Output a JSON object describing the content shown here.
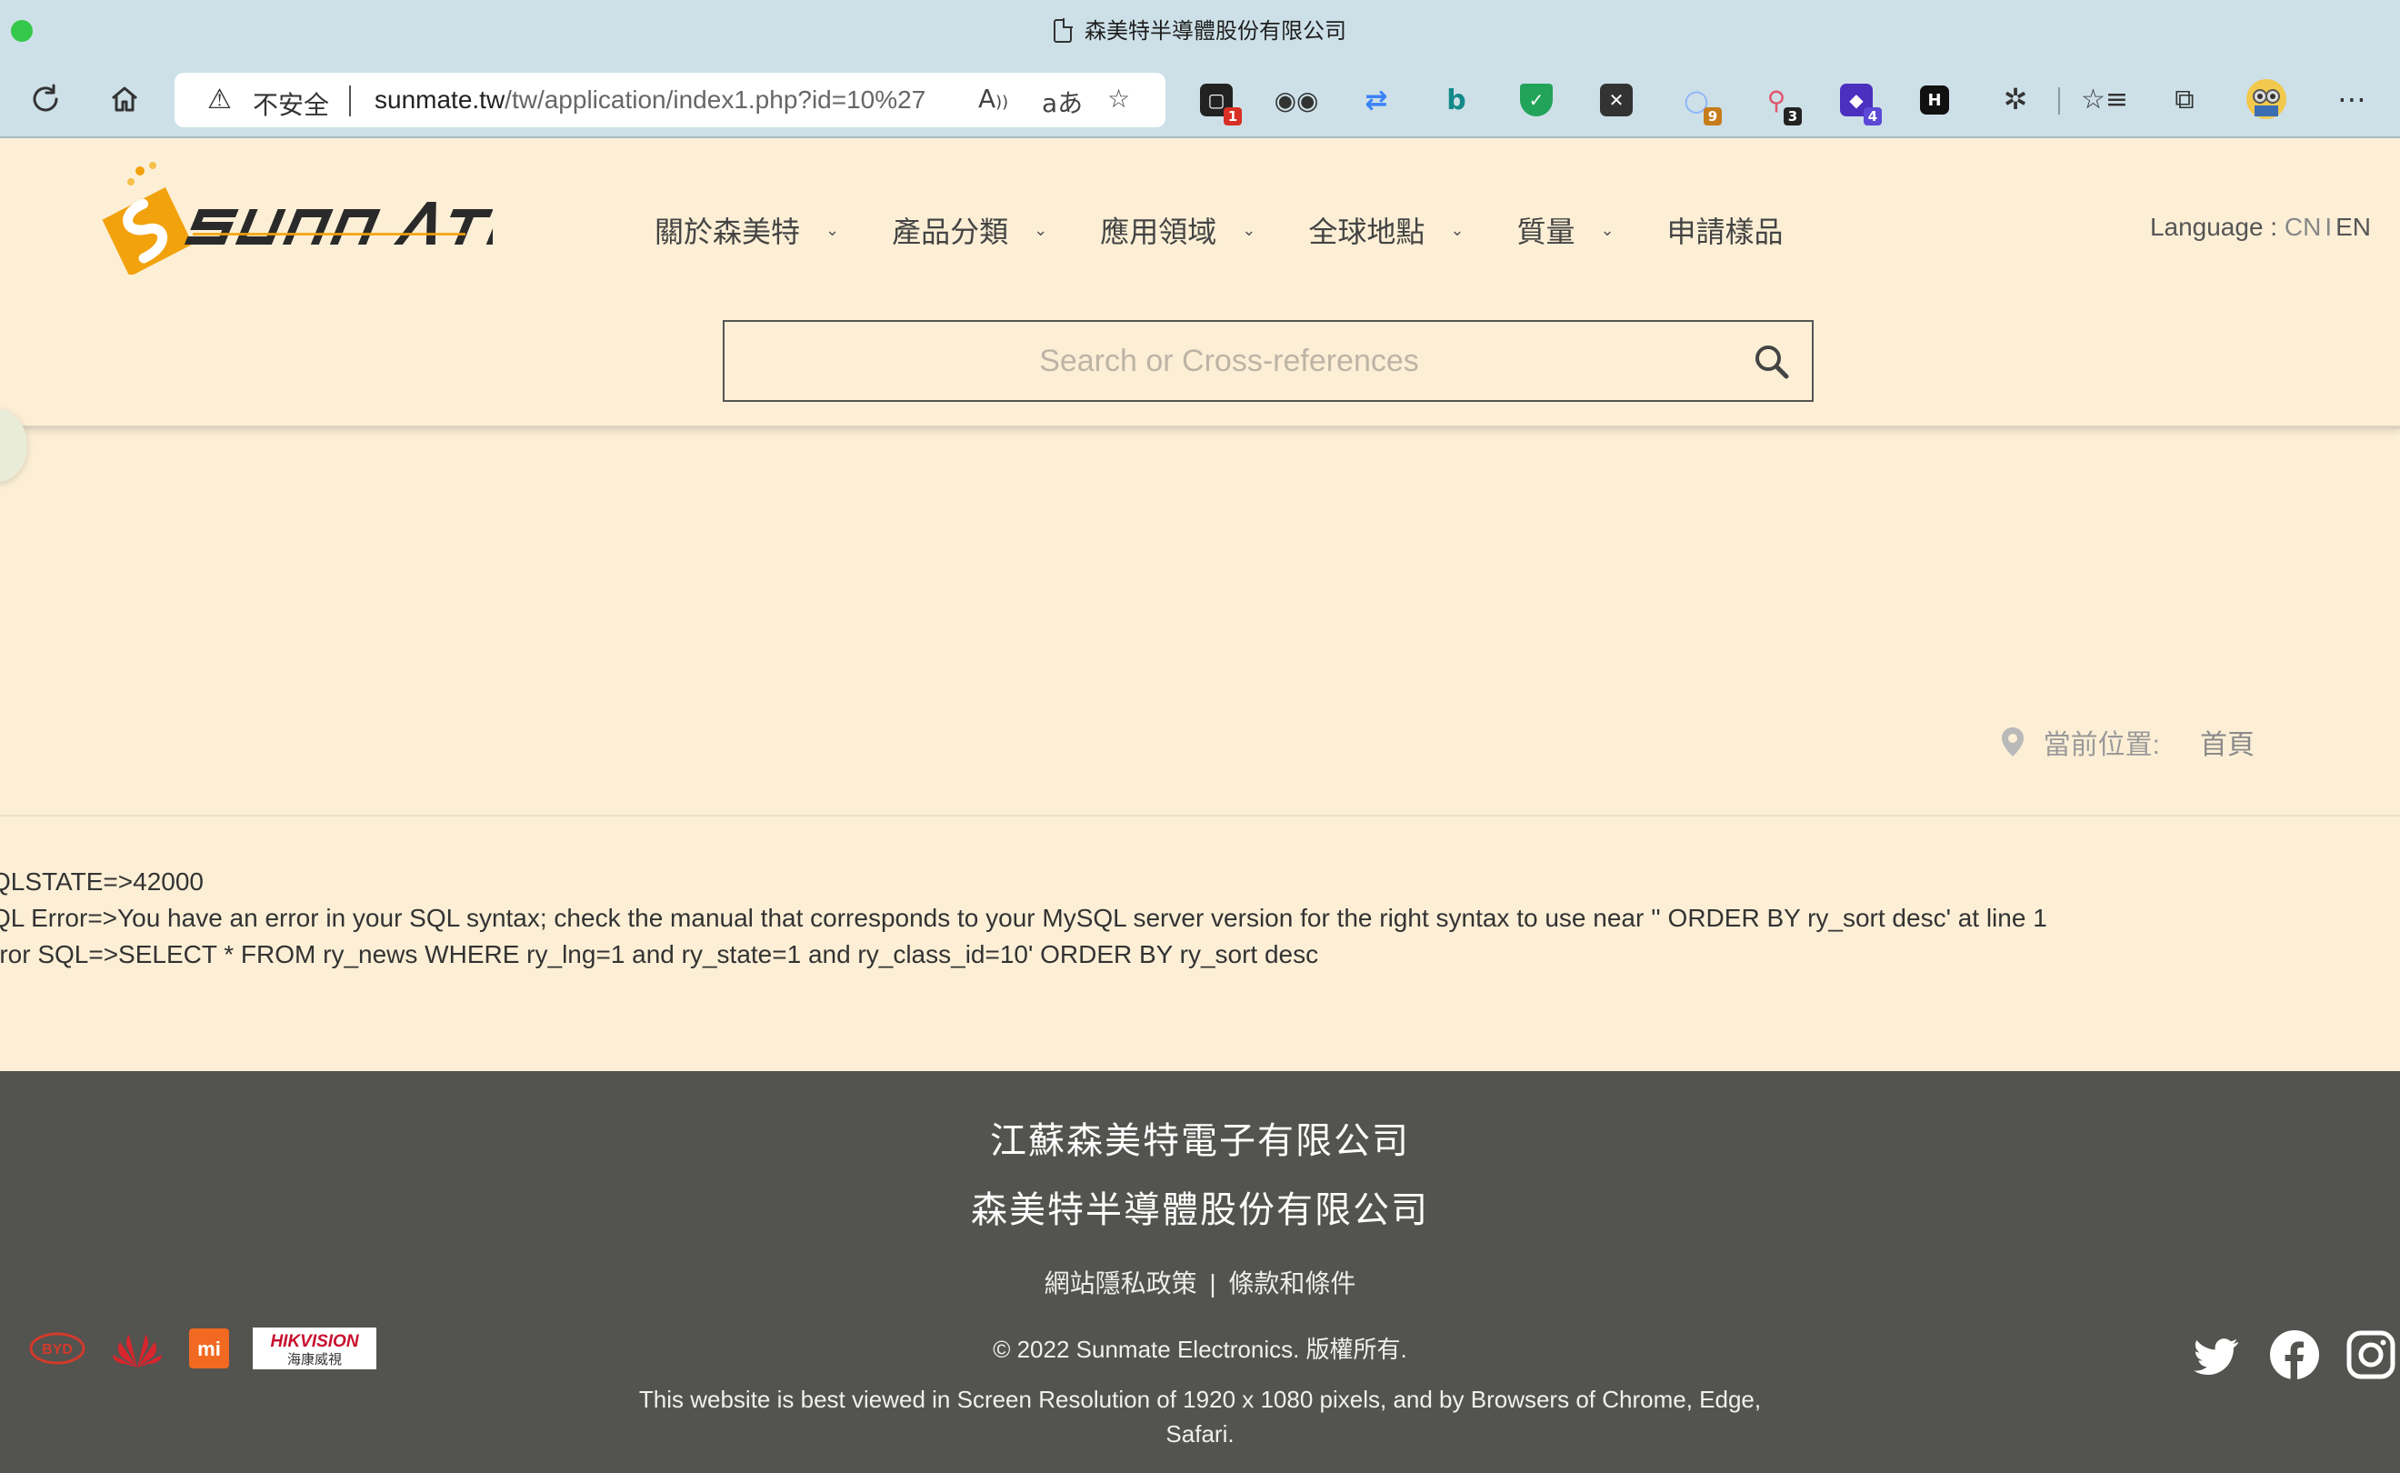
{
  "browser": {
    "tab_title": "森美特半導體股份有限公司",
    "insecure_label": "不安全",
    "url_host": "sunmate.tw",
    "url_path": "/tw/application/index1.php?id=10%27",
    "extensions": [
      {
        "name": "ext-1",
        "badge": "1",
        "color": "#222222",
        "badge_color": "#d93025"
      },
      {
        "name": "ext-spy",
        "badge": "",
        "color": "#444444"
      },
      {
        "name": "ext-repeat",
        "badge": "",
        "color": "#3b82f6"
      },
      {
        "name": "ext-bing",
        "badge": "",
        "color": "#138a8a"
      },
      {
        "name": "ext-shield",
        "badge": "",
        "color": "#22a35a"
      },
      {
        "name": "ext-x",
        "badge": "",
        "color": "#333333"
      },
      {
        "name": "ext-search",
        "badge": "9",
        "color": "#8ab4f8",
        "badge_color": "#c77c1b"
      },
      {
        "name": "ext-link",
        "badge": "3",
        "color": "#e0556b",
        "badge_color": "#222222"
      },
      {
        "name": "ext-cap",
        "badge": "4",
        "color": "#4b2fbf",
        "badge_color": "#5b48d6"
      },
      {
        "name": "ext-h",
        "badge": "",
        "color": "#111111"
      }
    ]
  },
  "header": {
    "logo_text": "SUNMATE",
    "nav": [
      {
        "label": "關於森美特",
        "has_dropdown": true
      },
      {
        "label": "產品分類",
        "has_dropdown": true
      },
      {
        "label": "應用領域",
        "has_dropdown": true
      },
      {
        "label": "全球地點",
        "has_dropdown": true
      },
      {
        "label": "質量",
        "has_dropdown": true
      },
      {
        "label": "申請樣品",
        "has_dropdown": false
      }
    ],
    "language_label": "Language : ",
    "lang_cn": "CN",
    "lang_sep": "I",
    "lang_en": "EN",
    "search_placeholder": "Search or Cross-references"
  },
  "breadcrumb": {
    "label": "當前位置:",
    "home": "首頁"
  },
  "error": {
    "line1": "QLSTATE=>42000",
    "line2": "QL Error=>You have an error in your SQL syntax; check the manual that corresponds to your MySQL server version for the right syntax to use near '' ORDER BY ry_sort desc' at line 1",
    "line3": "rror SQL=>SELECT * FROM ry_news WHERE ry_lng=1 and ry_state=1 and ry_class_id=10' ORDER BY ry_sort desc"
  },
  "footer": {
    "company_1": "江蘇森美特電子有限公司",
    "company_2": "森美特半導體股份有限公司",
    "privacy": "網站隱私政策",
    "link_sep": "|",
    "terms": "條款和條件",
    "copyright": "© 2022 Sunmate Electronics. 版權所有.",
    "note": "This website is best viewed in Screen Resolution of 1920 x 1080 pixels, and by Browsers of Chrome, Edge, Safari.",
    "partners": {
      "byd": "BYD",
      "mi": "mi",
      "hik_top": "HIKVISION",
      "hik_bottom": "海康威視"
    }
  },
  "colors": {
    "page_bg": "#fcefd6",
    "footer_bg": "#535350",
    "chrome_bg": "#cde0e8",
    "logo_orange": "#f2a20c"
  }
}
